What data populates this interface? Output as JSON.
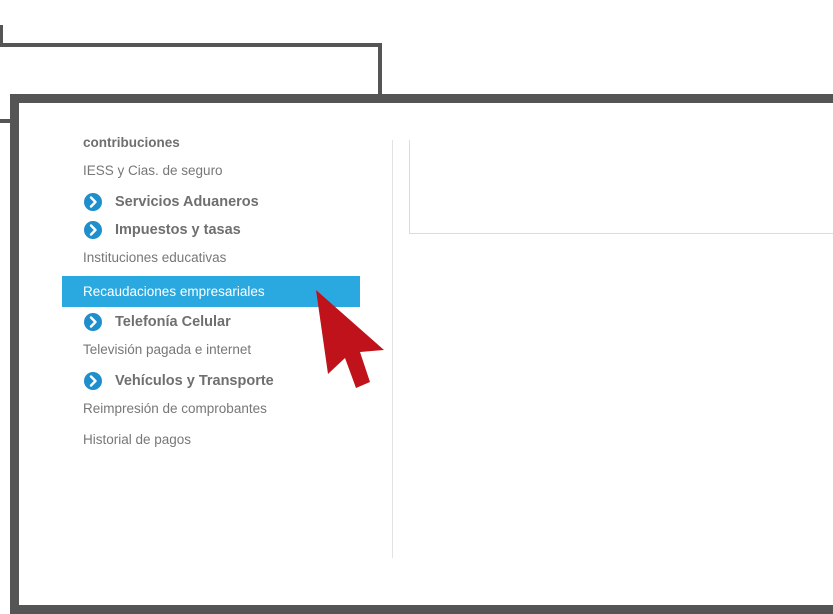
{
  "sidebar": {
    "items": [
      {
        "label": "contribuciones",
        "type": "header"
      },
      {
        "label": "IESS y Cias. de seguro",
        "type": "plain"
      },
      {
        "label": "Servicios Aduaneros",
        "type": "category",
        "icon": "chevron-right-circle-icon"
      },
      {
        "label": "Impuestos y tasas",
        "type": "category",
        "icon": "chevron-right-circle-icon"
      },
      {
        "label": "Instituciones educativas",
        "type": "plain"
      },
      {
        "label": "Recaudaciones empresariales",
        "type": "plain",
        "active": true
      },
      {
        "label": "Telefonía Celular",
        "type": "category",
        "icon": "chevron-right-circle-icon"
      },
      {
        "label": "Televisión pagada e internet",
        "type": "plain"
      },
      {
        "label": "Vehículos y Transporte",
        "type": "category",
        "icon": "chevron-right-circle-icon"
      },
      {
        "label": "Reimpresión de comprobantes",
        "type": "plain"
      },
      {
        "label": "Historial de pagos",
        "type": "plain"
      }
    ]
  },
  "colors": {
    "active_bg": "#2aa8e0",
    "category_icon": "#1e8fcc",
    "frame": "#555555",
    "cursor": "#c0121b"
  },
  "annotation": {
    "icon": "red-pointer-arrow-icon"
  }
}
